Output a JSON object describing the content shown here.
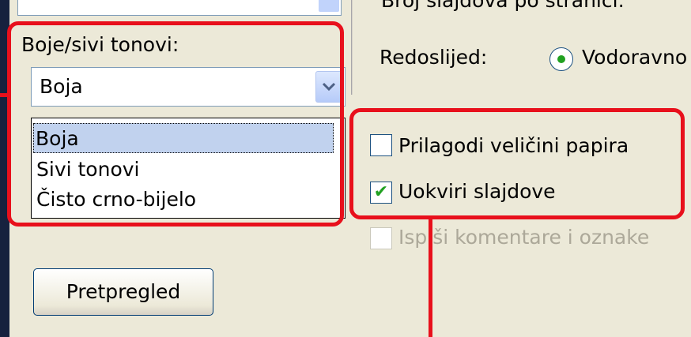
{
  "top_input": {
    "value": ""
  },
  "colors": {
    "label": "Boje/sivi tonovi:",
    "selected": "Boja",
    "options": [
      "Boja",
      "Sivi tonovi",
      "Čisto crno-bijelo"
    ]
  },
  "slides_per_page_label": "Broj slajdova po stranici:",
  "order": {
    "label": "Redoslijed:",
    "horizontal_label": "Vodoravno",
    "selected": "Vodoravno"
  },
  "checkboxes": [
    {
      "label": "Prilagodi veličini papira",
      "checked": false,
      "enabled": true
    },
    {
      "label": "Uokviri slajdove",
      "checked": true,
      "enabled": true
    },
    {
      "label": "Ispiši komentare i oznake",
      "checked": false,
      "enabled": false
    }
  ],
  "preview_button": "Pretpregled",
  "accent_color": "#e8101c",
  "icons": {
    "dropdown": "chevron-down-icon",
    "check": "check-icon"
  }
}
